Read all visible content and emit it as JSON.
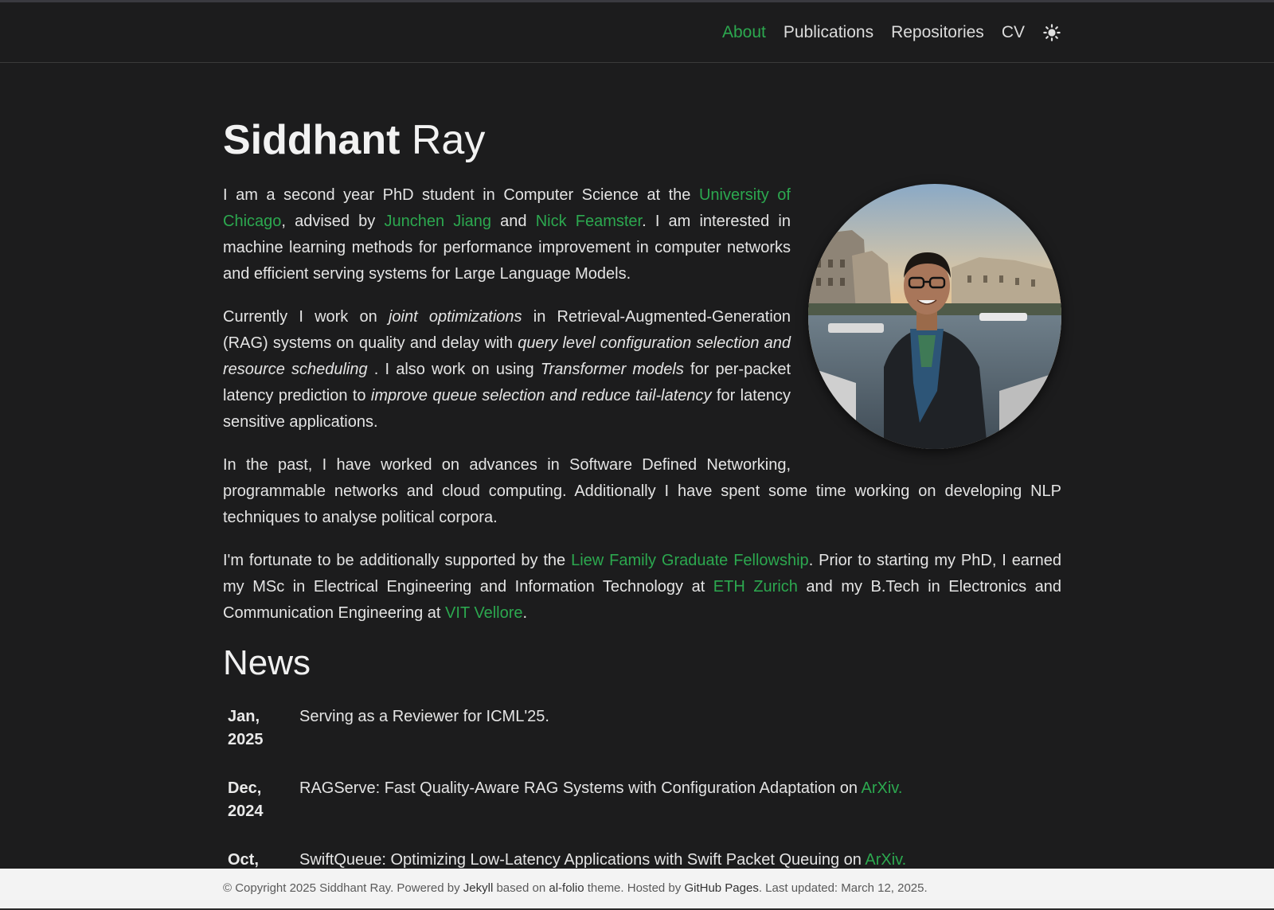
{
  "nav": {
    "items": [
      {
        "label": "About",
        "active": true
      },
      {
        "label": "Publications",
        "active": false
      },
      {
        "label": "Repositories",
        "active": false
      },
      {
        "label": "CV",
        "active": false
      }
    ],
    "theme_icon": "sun-icon"
  },
  "title": {
    "first": "Siddhant",
    "last": "Ray"
  },
  "about": {
    "p1": {
      "t1": "I am a second year PhD student in Computer Science at the ",
      "l1": "University of Chicago",
      "t2": ", advised by ",
      "l2": "Junchen Jiang",
      "t3": " and ",
      "l3": "Nick Feamster",
      "t4": ". I am interested in machine learning methods for performance improvement in computer networks and efficient serving systems for Large Language Models."
    },
    "p2": {
      "t1": "Currently I work on ",
      "e1": "joint optimizations",
      "t2": " in Retrieval-Augmented-Generation (RAG) systems on quality and delay with ",
      "e2": "query level configuration selection and resource scheduling",
      "t3": " . I also work on using ",
      "e3": "Transformer models",
      "t4": " for per-packet latency prediction to ",
      "e4": "improve queue selection and reduce tail-latency",
      "t5": " for latency sensitive applications."
    },
    "p3": "In the past, I have worked on advances in Software Defined Networking, programmable networks and cloud computing. Additionally I have spent some time working on developing NLP techniques to analyse political corpora.",
    "p4": {
      "t1": "I'm fortunate to be additionally supported by the ",
      "l1": "Liew Family Graduate Fellowship",
      "t2": ". Prior to starting my PhD, I earned my MSc in Electrical Engineering and Information Technology at ",
      "l2": "ETH Zurich",
      "t3": " and my B.Tech in Electronics and Communication Engineering at ",
      "l3": "VIT Vellore",
      "t4": "."
    }
  },
  "news": {
    "heading": "News",
    "items": [
      {
        "date": "Jan, 2025",
        "text": "Serving as a Reviewer for ICML'25.",
        "link": ""
      },
      {
        "date": "Dec, 2024",
        "text": "RAGServe: Fast Quality-Aware RAG Systems with Configuration Adaptation on ",
        "link": "ArXiv."
      },
      {
        "date": "Oct,",
        "text": "SwiftQueue: Optimizing Low-Latency Applications with Swift Packet Queuing on ",
        "link": "ArXiv."
      }
    ]
  },
  "footer": {
    "t1": "© Copyright 2025 Siddhant Ray. Powered by ",
    "l1": "Jekyll",
    "t2": " based on ",
    "l2": "al-folio",
    "t3": " theme. Hosted by ",
    "l3": "GitHub Pages",
    "t4": ". Last updated: March 12, 2025."
  },
  "colors": {
    "accent": "#2ca84f",
    "background": "#1c1c1d",
    "footer_bg": "#f3f3f3"
  }
}
